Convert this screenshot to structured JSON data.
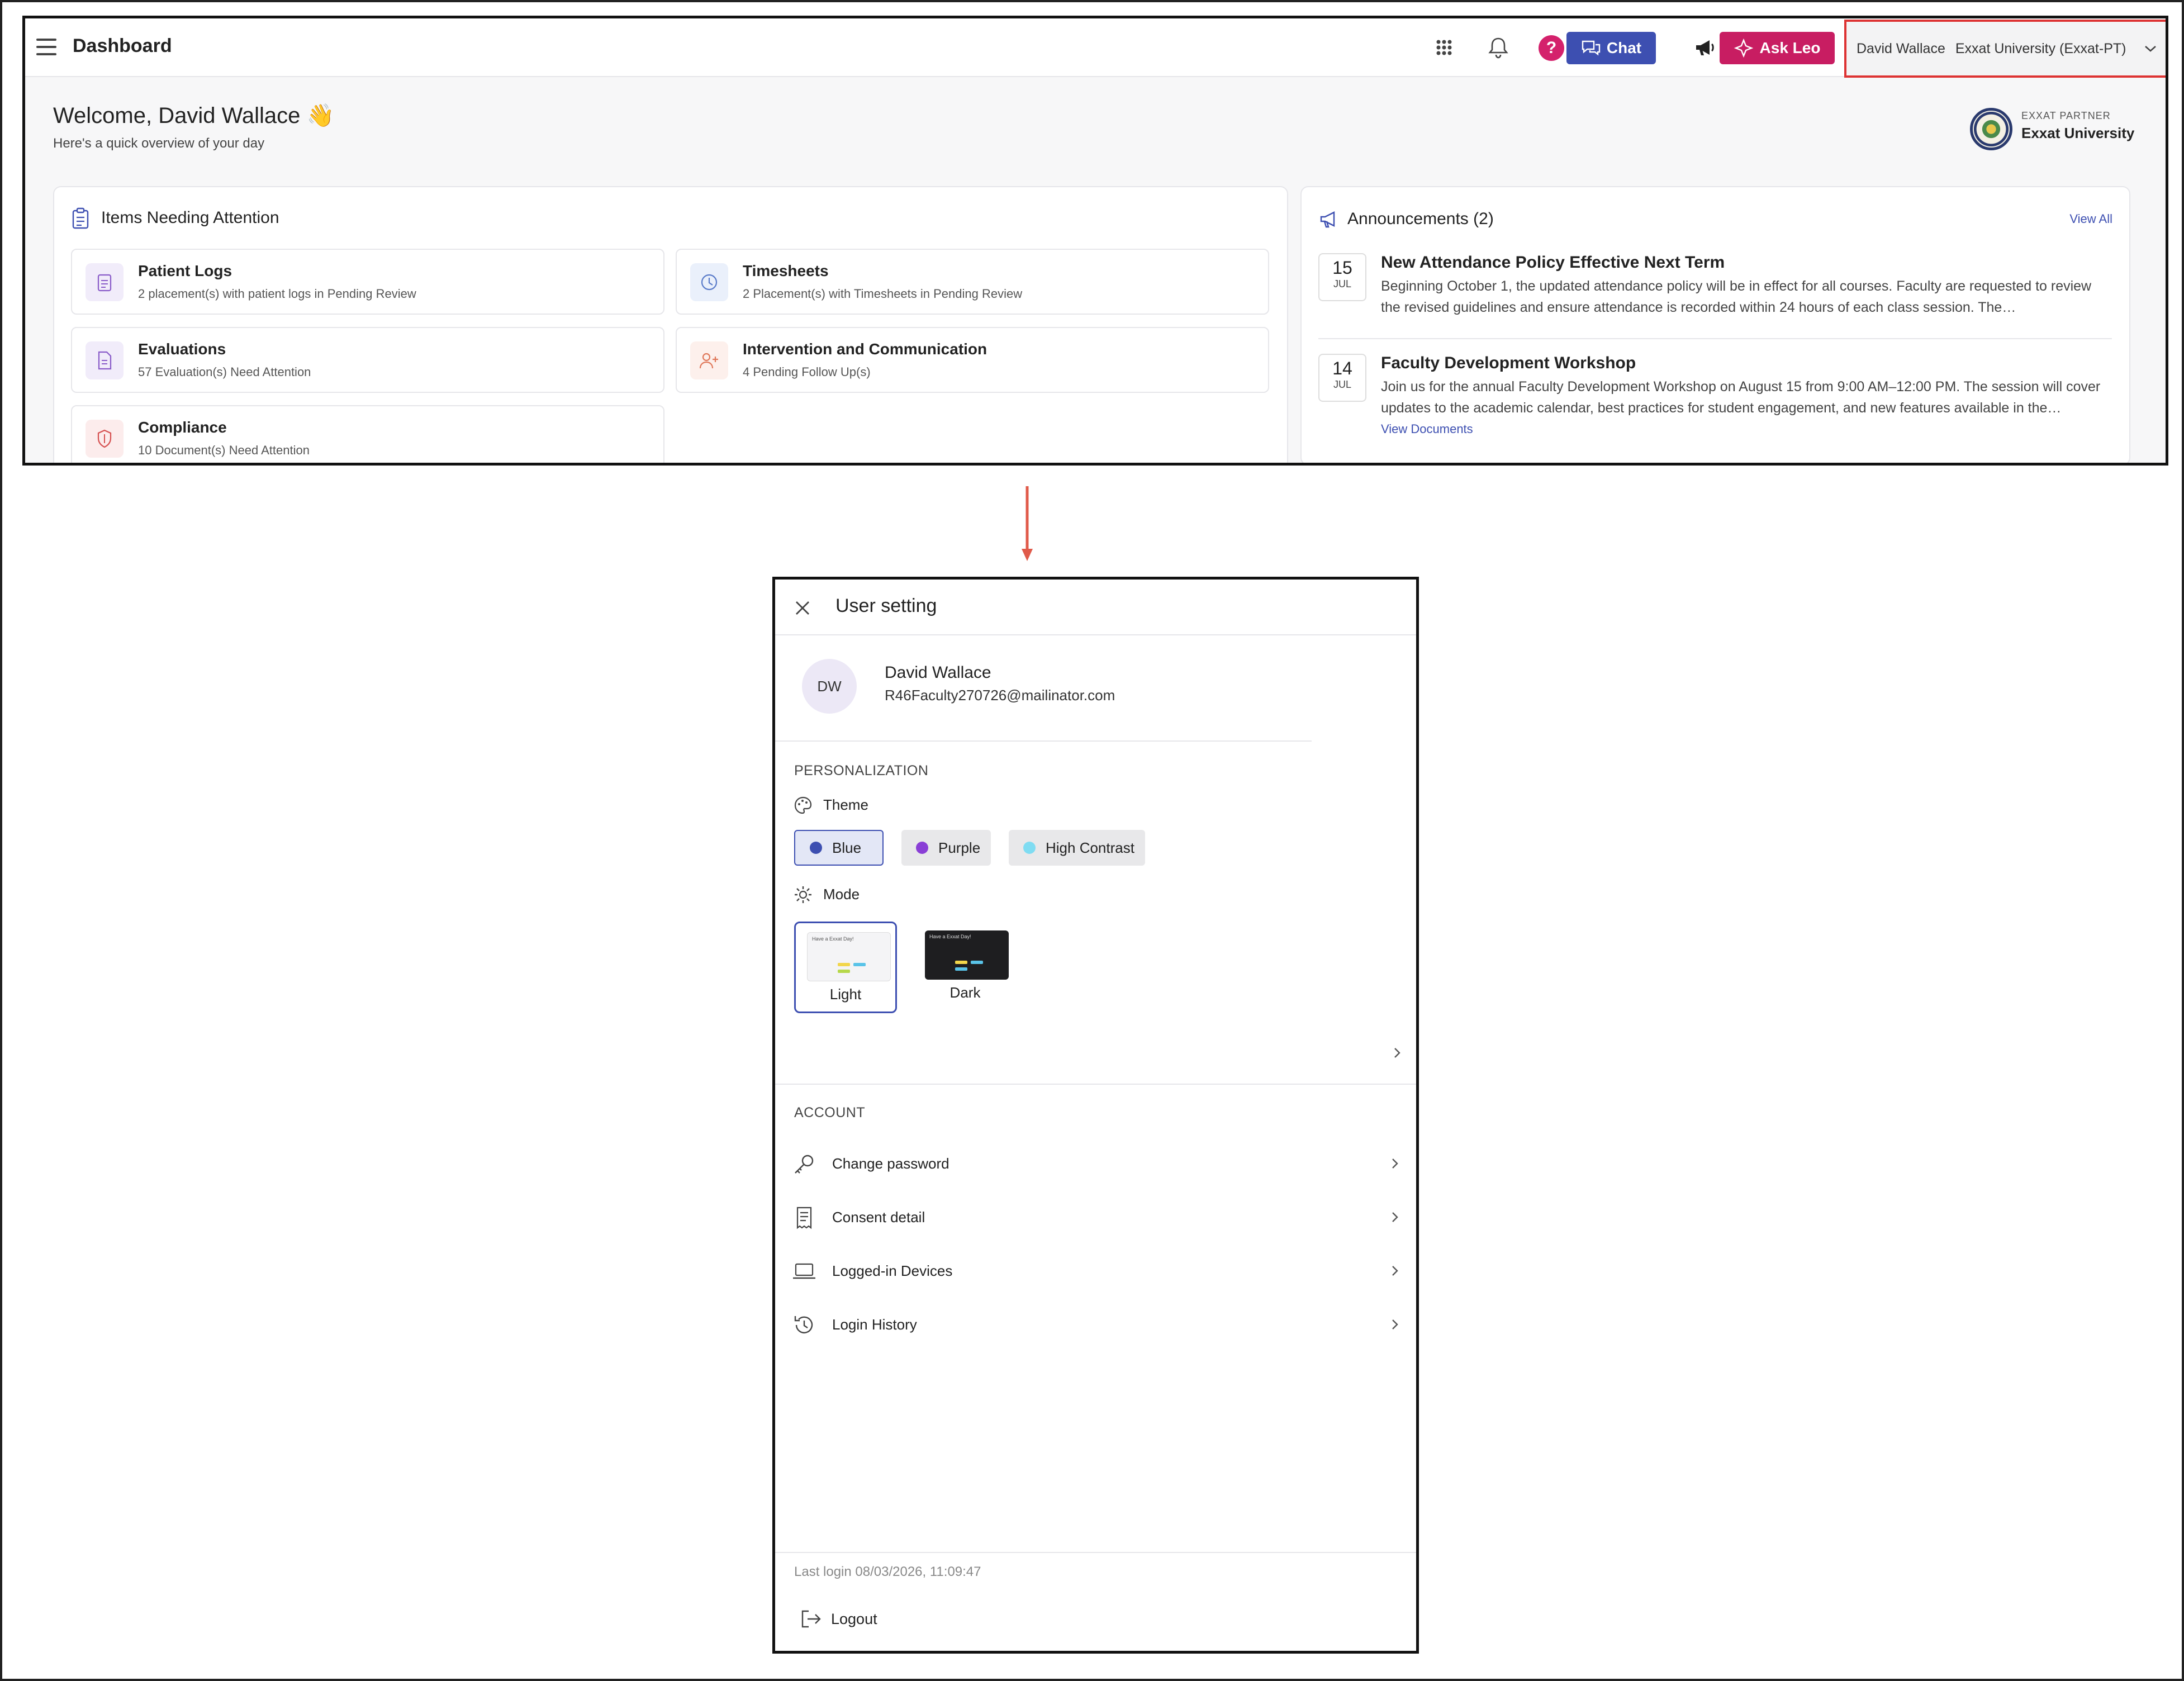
{
  "dashboard": {
    "title": "Dashboard",
    "buttons": {
      "chat": "Chat",
      "ask_leo": "Ask Leo"
    },
    "user_switch": {
      "name": "David Wallace",
      "org": "Exxat University (Exxat-PT)"
    },
    "welcome": "Welcome, David Wallace 👋",
    "welcome_sub": "Here's a quick overview of your day",
    "partner": {
      "label": "EXXAT PARTNER",
      "name": "Exxat University"
    },
    "attention": {
      "title": "Items Needing Attention",
      "items": [
        {
          "title": "Patient Logs",
          "desc": "2 placement(s) with patient logs in Pending Review"
        },
        {
          "title": "Timesheets",
          "desc": "2 Placement(s) with Timesheets in Pending Review"
        },
        {
          "title": "Evaluations",
          "desc": "57 Evaluation(s) Need Attention"
        },
        {
          "title": "Intervention and Communication",
          "desc": "4 Pending Follow Up(s)"
        },
        {
          "title": "Compliance",
          "desc": "10 Document(s) Need Attention"
        }
      ]
    },
    "announcements": {
      "title": "Announcements (2)",
      "view_all": "View All",
      "items": [
        {
          "day": "15",
          "month": "JUL",
          "title": "New Attendance Policy Effective Next Term",
          "body": "Beginning October 1, the updated attendance policy will be in effect for all courses. Faculty are requested to review the revised guidelines and ensure attendance is recorded within 24 hours of each class session. The…"
        },
        {
          "day": "14",
          "month": "JUL",
          "title": "Faculty Development Workshop",
          "body": "Join us for the annual Faculty Development Workshop on August 15 from 9:00 AM–12:00 PM. The session will cover updates to the academic calendar, best practices for student engagement, and new features available in the…",
          "link": "View Documents"
        }
      ]
    }
  },
  "user_setting": {
    "title": "User setting",
    "avatar_initials": "DW",
    "name": "David Wallace",
    "email": "R46Faculty270726@mailinator.com",
    "personalization_label": "PERSONALIZATION",
    "theme_label": "Theme",
    "themes": [
      {
        "label": "Blue",
        "color": "#3d4fb1",
        "selected": true
      },
      {
        "label": "Purple",
        "color": "#8a3fd6",
        "selected": false
      },
      {
        "label": "High Contrast",
        "color": "#7fdcf2",
        "selected": false
      }
    ],
    "mode_label": "Mode",
    "modes": [
      {
        "label": "Light",
        "preview_text": "Have a Exxat Day!",
        "selected": true
      },
      {
        "label": "Dark",
        "preview_text": "Have a Exxat Day!",
        "selected": false
      }
    ],
    "account_label": "ACCOUNT",
    "account_items": [
      {
        "label": "Change password",
        "icon": "key-icon"
      },
      {
        "label": "Consent detail",
        "icon": "receipt-icon"
      },
      {
        "label": "Logged-in Devices",
        "icon": "laptop-icon"
      },
      {
        "label": "Login History",
        "icon": "history-icon"
      }
    ],
    "last_login": "Last login 08/03/2026, 11:09:47",
    "logout": "Logout"
  },
  "colors": {
    "primary": "#3d4fb1",
    "ask_leo": "#c81d62",
    "highlight_border": "#dd3333",
    "arrow": "#e05a4a"
  }
}
